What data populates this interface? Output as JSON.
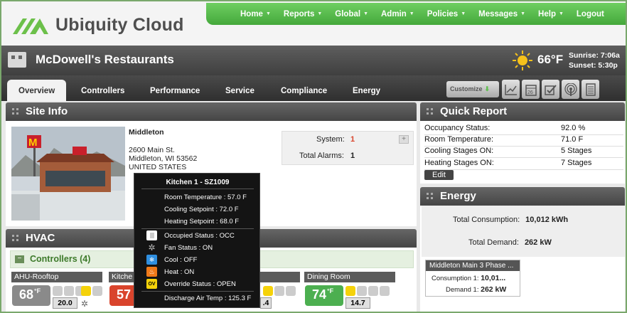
{
  "brand": {
    "name": "Ubiquity Cloud"
  },
  "nav": [
    "Home",
    "Reports",
    "Global",
    "Admin",
    "Policies",
    "Messages",
    "Help",
    "Logout"
  ],
  "site": {
    "name": "McDowell's Restaurants"
  },
  "weather": {
    "temp": "66°F",
    "sunrise": "Sunrise: 7:06a",
    "sunset": "Sunset: 5:30p"
  },
  "tabs": [
    "Overview",
    "Controllers",
    "Performance",
    "Service",
    "Compliance",
    "Energy"
  ],
  "toolbar": {
    "customize": "Customize"
  },
  "site_info": {
    "title": "Site Info",
    "location": "Middleton",
    "address1": "2600 Main St.",
    "address2": "Middleton, WI 53562",
    "country": "UNITED STATES",
    "system_label": "System:",
    "system_value": "1",
    "alarms_label": "Total Alarms:",
    "alarms_value": "1"
  },
  "quick_report": {
    "title": "Quick Report",
    "rows": [
      {
        "label": "Occupancy Status:",
        "value": "92.0 %"
      },
      {
        "label": "Room Temperature:",
        "value": "71.0 F"
      },
      {
        "label": "Cooling Stages ON:",
        "value": "5 Stages"
      },
      {
        "label": "Heating Stages ON:",
        "value": "7 Stages"
      }
    ],
    "edit": "Edit"
  },
  "energy": {
    "title": "Energy",
    "consumption_label": "Total Consumption:",
    "consumption_value": "10,012 kWh",
    "demand_label": "Total Demand:",
    "demand_value": "262 kW",
    "meter_title": "Middleton Main 3 Phase ...",
    "meter_consumption_label": "Consumption 1:",
    "meter_consumption_value": "10,01...",
    "meter_demand_label": "Demand 1:",
    "meter_demand_value": "262 kW"
  },
  "hvac": {
    "title": "HVAC",
    "controllers_title": "Controllers (4)",
    "units": [
      {
        "name": "AHU-Rooftop",
        "temp": "68",
        "unit": "°F",
        "setpoint": "20.0",
        "color": "#8a8a8a"
      },
      {
        "name": "Kitche",
        "temp": "57",
        "unit": "",
        "setpoint": "",
        "color": "#d9442c"
      },
      {
        "name": "",
        "temp": "",
        "unit": "",
        "setpoint": ".4",
        "color": "#8a8a8a"
      },
      {
        "name": "Dining Room",
        "temp": "74",
        "unit": "°F",
        "setpoint": "14.7",
        "color": "#4caf50"
      }
    ]
  },
  "tooltip": {
    "title": "Kitchen 1 - SZ1009",
    "room_temp": "Room Temperature : 57.0 F",
    "cool_sp": "Cooling Setpoint : 72.0 F",
    "heat_sp": "Heating Setpoint : 68.0 F",
    "occupied": "Occupied Status : OCC",
    "fan": "Fan Status : ON",
    "cool": "Cool : OFF",
    "heat": "Heat : ON",
    "override": "Override Status : OPEN",
    "override_icon": "OV",
    "discharge": "Discharge Air Temp : 125.3 F"
  },
  "colors": {
    "nav_green": "#4caf50",
    "alarm_red": "#d9442c",
    "header_dark": "#4a4a4a"
  }
}
